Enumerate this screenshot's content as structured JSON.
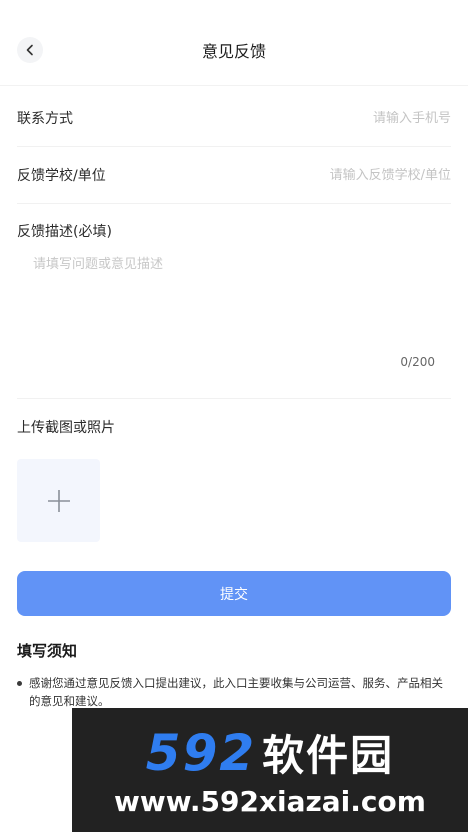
{
  "header": {
    "title": "意见反馈"
  },
  "form": {
    "contact": {
      "label": "联系方式",
      "placeholder": "请输入手机号"
    },
    "school": {
      "label": "反馈学校/单位",
      "placeholder": "请输入反馈学校/单位"
    },
    "description": {
      "label": "反馈描述(必填)",
      "placeholder": "请填写问题或意见描述",
      "count": "0/200"
    },
    "upload": {
      "label": "上传截图或照片"
    },
    "submit_label": "提交"
  },
  "notice": {
    "title": "填写须知",
    "items": [
      "感谢您通过意见反馈入口提出建议，此入口主要收集与公司运营、服务、产品相关的意见和建议。"
    ]
  },
  "watermark": {
    "digits": "592",
    "cn": "软件园",
    "url": "www.592xiazai.com"
  },
  "colors": {
    "primary": "#6193f6",
    "upload_bg": "#f3f6fd",
    "watermark_blue": "#2f7df0"
  }
}
